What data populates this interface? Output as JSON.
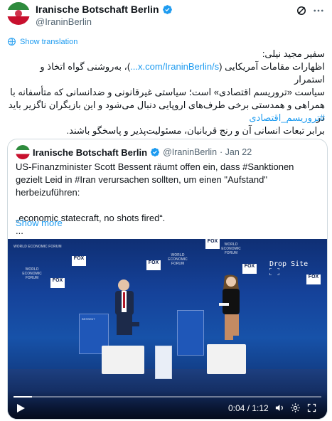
{
  "tweet": {
    "author_name": "Iranische Botschaft Berlin",
    "handle": "@IraninBerlin",
    "translate_label": "Show translation",
    "text_line1": "سفیر مجید نیلی:",
    "text_line2_a": "اظهارات مقامات آمریکایی (",
    "text_link": "x.com/IraninBerlin/s...",
    "text_line2_b": ")، به‌روشنی گواه اتخاذ و استمرار",
    "text_rest": "سیاست «تروریسم اقتصادی» است؛ سیاستی غیرقانونی و ضدانسانی که متأسفانه با\nهمراهی و همدستی برخی طرف‌های اروپایی دنبال می‌شود و این بازیگران ناگزیر باید در\nبرابر تبعات انسانی آن و رنج قربانیان، مسئولیت‌پذیر و پاسخگو باشند.",
    "hashtag": "#تروریسم_اقتصادی"
  },
  "quote": {
    "author_name": "Iranische Botschaft Berlin",
    "handle": "@IraninBerlin",
    "date": "· Jan 22",
    "text_p1": "US-Finanzminister Scott Bessent räumt offen ein, dass #Sanktionen gezielt Leid in #Iran verursachen sollten, um einen \"Aufstand\" herbeizuführen:",
    "text_p2": "„economic statecraft, no shots fired“.",
    "text_p3": "...",
    "show_more": "Show more"
  },
  "video": {
    "time": "0:04 / 1:12",
    "progress": 0.06,
    "watermark": "Drop Site",
    "wef_logo": "WORLD ECONOMIC FORUM",
    "fox_logo": "FOX BUSINESS",
    "podium_left": "BESSENT"
  },
  "colors": {
    "link": "#1d9bf0",
    "verified": "#1d9bf0"
  }
}
